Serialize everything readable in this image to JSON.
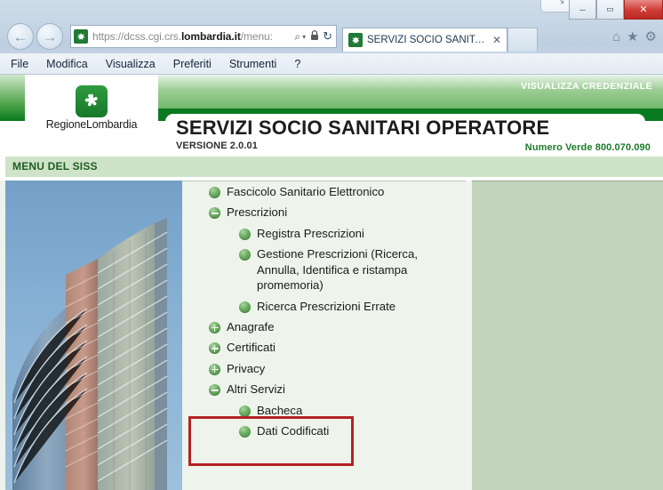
{
  "browser": {
    "window_controls": {
      "restore_label": "❐",
      "minimize_label": "─",
      "maximize_label": "▭",
      "close_label": "✕",
      "expand_label": "⤡",
      "chevron_label": "⌄"
    },
    "nav": {
      "back_label": "←",
      "forward_label": "→"
    },
    "address": {
      "url_prefix": "https://dcss.cgi.crs.",
      "url_domain": "lombardia.it",
      "url_suffix": "/menu:",
      "full_url": "https://dcss.cgi.crs.lombardia.it/menu:",
      "search_icon": "⌕",
      "caret_icon": "▾",
      "lock_icon": "🔒",
      "refresh_icon": "↻"
    },
    "tabs": [
      {
        "title": "SERVIZI SOCIO SANITARI O...",
        "close_label": "✕"
      }
    ],
    "toolbar_icons": [
      {
        "name": "home-icon",
        "glyph": "⌂"
      },
      {
        "name": "favorites-star-icon",
        "glyph": "★"
      },
      {
        "name": "settings-gear-icon",
        "glyph": "⚙"
      }
    ],
    "menubar": [
      {
        "label": "File"
      },
      {
        "label": "Modifica"
      },
      {
        "label": "Visualizza"
      },
      {
        "label": "Preferiti"
      },
      {
        "label": "Strumenti"
      },
      {
        "label": "?"
      }
    ]
  },
  "header": {
    "logo_text": "RegioneLombardia",
    "title": "SERVIZI SOCIO SANITARI OPERATORE",
    "version": "VERSIONE 2.0.01",
    "credenziale_link": "VISUALIZZA CREDENZIALE",
    "menu_bar_label": "MENU DEL SISS",
    "numero_verde": "Numero Verde 800.070.090"
  },
  "colors": {
    "brand_green_dark": "#0a7a20",
    "brand_green_mid": "#57a84f",
    "brand_green_light": "#cfe3c8",
    "panel_right": "#c3d6bd",
    "menu_panel": "#eef3ec",
    "highlight_red": "#b32222",
    "numero_verde_text": "#1e7a2a",
    "menu_siss_text": "#1f5d23"
  },
  "menu_tree": [
    {
      "label": "Fascicolo Sanitario Elettronico",
      "level": 0,
      "state": "leaf"
    },
    {
      "label": "Prescrizioni",
      "level": 0,
      "state": "expanded"
    },
    {
      "label": "Registra Prescrizioni",
      "level": 1,
      "state": "leaf"
    },
    {
      "label": "Gestione Prescrizioni (Ricerca, Annulla, Identifica e ristampa promemoria)",
      "level": 1,
      "state": "leaf"
    },
    {
      "label": "Ricerca Prescrizioni Errate",
      "level": 1,
      "state": "leaf"
    },
    {
      "label": "Anagrafe",
      "level": 0,
      "state": "collapsed"
    },
    {
      "label": "Certificati",
      "level": 0,
      "state": "collapsed"
    },
    {
      "label": "Privacy",
      "level": 0,
      "state": "collapsed"
    },
    {
      "label": "Altri Servizi",
      "level": 0,
      "state": "expanded"
    },
    {
      "label": "Bacheca",
      "level": 1,
      "state": "leaf"
    },
    {
      "label": "Dati Codificati",
      "level": 1,
      "state": "leaf"
    }
  ],
  "annotation": {
    "type": "rectangle",
    "color": "#b32222",
    "covers": [
      "Altri Servizi",
      "Bacheca"
    ]
  },
  "sidebar_image": {
    "alt": "Palazzo Lombardia tower against blue sky"
  }
}
